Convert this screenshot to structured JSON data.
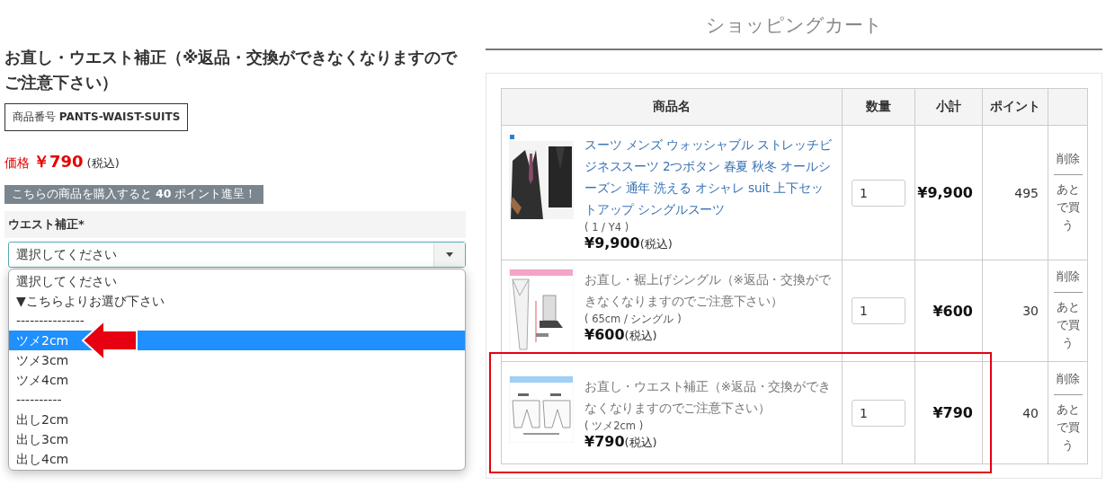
{
  "product": {
    "title": "お直し・ウエスト補正（※返品・交換ができなくなりますのでご注意下さい）",
    "code_label": "商品番号",
    "code": "PANTS-WAIST-SUITS",
    "price_label": "価格",
    "price": "￥790",
    "tax_note": "(税込)",
    "points_banner": "こちらの商品を購入すると **40** ポイント進呈！",
    "option_label": "ウエスト補正",
    "required_mark": "*",
    "select_value": "選択してください",
    "options": [
      {
        "label": "選択してください",
        "selected": false
      },
      {
        "label": "▼こちらよりお選び下さい",
        "selected": false
      },
      {
        "label": "---------------",
        "selected": false
      },
      {
        "label": "ツメ2cm",
        "selected": true
      },
      {
        "label": "ツメ3cm",
        "selected": false
      },
      {
        "label": "ツメ4cm",
        "selected": false
      },
      {
        "label": "----------",
        "selected": false
      },
      {
        "label": "出し2cm",
        "selected": false
      },
      {
        "label": "出し3cm",
        "selected": false
      },
      {
        "label": "出し4cm",
        "selected": false
      }
    ]
  },
  "cart": {
    "title": "ショッピングカート",
    "columns": [
      "商品名",
      "数量",
      "小計",
      "ポイント"
    ],
    "rows": [
      {
        "kind": "link",
        "name": "スーツ メンズ ウォッシャブル ストレッチビジネススーツ 2つボタン 春夏 秋冬 オールシーズン 通年 洗える オシャレ suit 上下セットアップ シングルスーツ",
        "variant": "( 1 / Y4 )",
        "price": "¥9,900",
        "tax_note": "(税込)",
        "quantity": "1",
        "subtotal": "¥9,900",
        "points": "495",
        "delete": "削除",
        "later": "あとで買う",
        "highlighted": false
      },
      {
        "kind": "text",
        "name": "お直し・裾上げシングル（※返品・交換ができなくなりますのでご注意下さい）",
        "variant": "( 65cm / シングル )",
        "price": "¥600",
        "tax_note": "(税込)",
        "quantity": "1",
        "subtotal": "¥600",
        "points": "30",
        "delete": "削除",
        "later": "あとで買う",
        "highlighted": false
      },
      {
        "kind": "text",
        "name": "お直し・ウエスト補正（※返品・交換ができなくなりますのでご注意下さい）",
        "variant": "( ツメ2cm )",
        "price": "¥790",
        "tax_note": "(税込)",
        "quantity": "1",
        "subtotal": "¥790",
        "points": "40",
        "delete": "削除",
        "later": "あとで買う",
        "highlighted": true
      }
    ]
  }
}
